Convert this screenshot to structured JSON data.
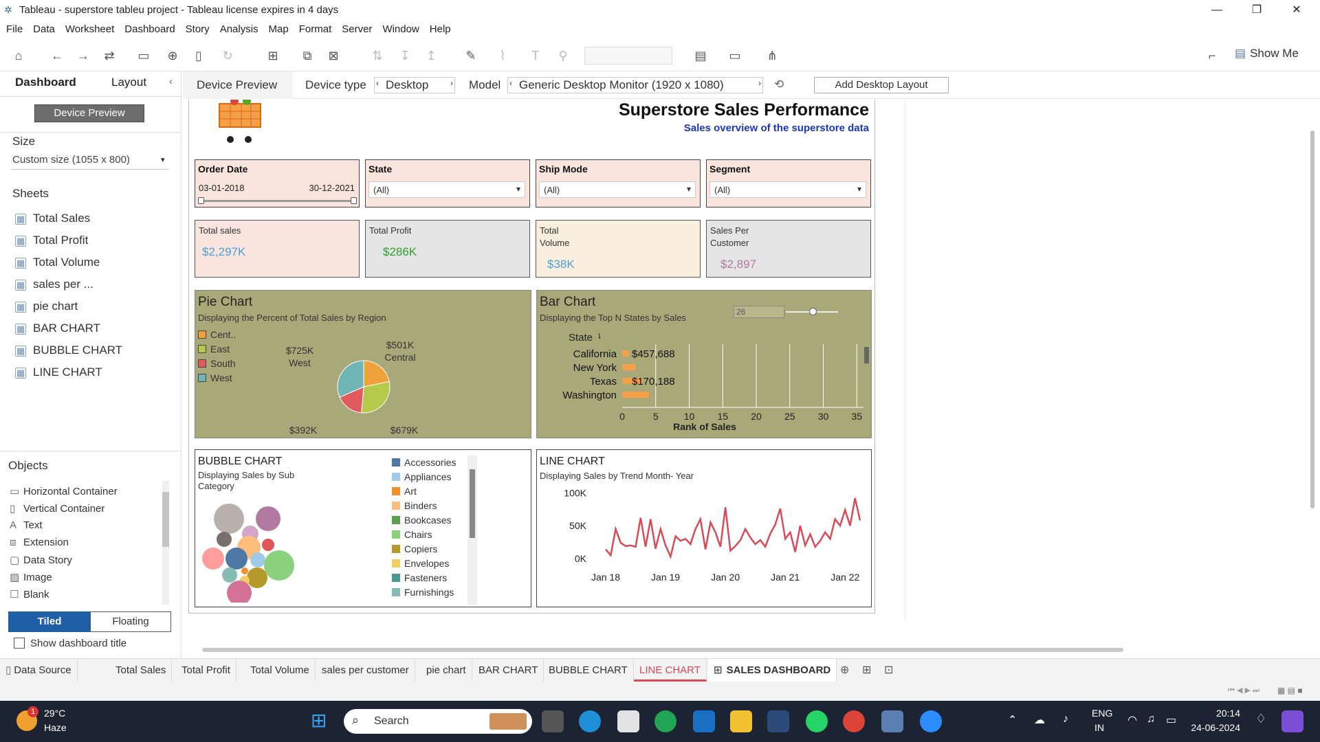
{
  "window": {
    "title": "Tableau - superstore tableu project - Tableau license expires in 4 days"
  },
  "menu": [
    "File",
    "Data",
    "Worksheet",
    "Dashboard",
    "Story",
    "Analysis",
    "Map",
    "Format",
    "Server",
    "Window",
    "Help"
  ],
  "toolbar": {
    "show_me": "Show Me"
  },
  "left_panel": {
    "tabs": {
      "dashboard": "Dashboard",
      "layout": "Layout"
    },
    "device_preview_btn": "Device Preview",
    "size_heading": "Size",
    "size_value": "Custom size (1055 x 800)",
    "sheets_heading": "Sheets",
    "sheets": [
      "Total Sales",
      "Total Profit",
      "Total Volume",
      "sales per ...",
      "pie chart",
      "BAR CHART",
      "BUBBLE CHART",
      "LINE CHART"
    ],
    "objects_heading": "Objects",
    "objects": [
      "Horizontal Container",
      "Vertical Container",
      "Text",
      "Extension",
      "Data Story",
      "Image",
      "Blank"
    ],
    "tiled": "Tiled",
    "floating": "Floating",
    "show_title": "Show dashboard title"
  },
  "device_bar": {
    "preview": "Device Preview",
    "device_type_label": "Device type",
    "device_type": "Desktop",
    "model_label": "Model",
    "model": "Generic Desktop Monitor (1920 x 1080)",
    "add_layout": "Add Desktop Layout"
  },
  "dashboard": {
    "title": "Superstore Sales Performance",
    "subtitle": "Sales overview of the superstore data",
    "filters": [
      {
        "label": "Order Date",
        "start": "03-01-2018",
        "end": "30-12-2021"
      },
      {
        "label": "State",
        "value": "(All)"
      },
      {
        "label": "Ship Mode",
        "value": "(All)"
      },
      {
        "label": "Segment",
        "value": "(All)"
      }
    ],
    "kpis": [
      {
        "label": "Total sales",
        "value": "$2,297K",
        "bg": "#f9e5dd",
        "color": "#4a9fd6"
      },
      {
        "label": "Total Profit",
        "value": "$286K",
        "bg": "#e5e5e5",
        "color": "#2e9e2e"
      },
      {
        "label": "Total\nVolume",
        "value": "$38K",
        "bg": "#faefde",
        "color": "#4a9fd6"
      },
      {
        "label": "Sales Per\nCustomer",
        "value": "$2,897",
        "bg": "#e5e5e5",
        "color": "#b07aa1"
      }
    ],
    "pie": {
      "title": "Pie Chart",
      "subtitle": "Displaying the Percent of Total Sales by Region",
      "legend": [
        {
          "name": "Cent..",
          "color": "#f0a23a"
        },
        {
          "name": "East",
          "color": "#b5c94a"
        },
        {
          "name": "South",
          "color": "#e05a5e"
        },
        {
          "name": "West",
          "color": "#6fb5b5"
        }
      ],
      "labels": [
        {
          "v": "$725K",
          "r": "West"
        },
        {
          "v": "$501K",
          "r": "Central"
        },
        {
          "v": "$392K",
          "r": "South"
        },
        {
          "v": "$679K",
          "r": "East"
        }
      ]
    },
    "bar": {
      "title": "Bar Chart",
      "subtitle": "Displaying the Top N States by Sales",
      "param": "26",
      "state_header": "State",
      "states": [
        "California",
        "New York",
        "Texas",
        "Washington"
      ],
      "labels": [
        "$457,688",
        "$170,188"
      ],
      "xlabel": "Rank of Sales",
      "ticks": [
        "0",
        "5",
        "10",
        "15",
        "20",
        "25",
        "30",
        "35"
      ]
    },
    "bubble": {
      "title": "BUBBLE CHART",
      "subtitle": "Displaying Sales by Sub\nCategory",
      "legend": [
        {
          "name": "Accessories",
          "color": "#4e79a7"
        },
        {
          "name": "Appliances",
          "color": "#a0cbe8"
        },
        {
          "name": "Art",
          "color": "#f28e2b"
        },
        {
          "name": "Binders",
          "color": "#ffbe7d"
        },
        {
          "name": "Bookcases",
          "color": "#59a14f"
        },
        {
          "name": "Chairs",
          "color": "#8cd17d"
        },
        {
          "name": "Copiers",
          "color": "#b6992d"
        },
        {
          "name": "Envelopes",
          "color": "#f1ce63"
        },
        {
          "name": "Fasteners",
          "color": "#499894"
        },
        {
          "name": "Furnishings",
          "color": "#86bcb6"
        }
      ]
    },
    "line": {
      "title": "LINE CHART",
      "subtitle": "Displaying Sales by Trend Month- Year",
      "yticks": [
        "100K",
        "50K",
        "0K"
      ],
      "xticks": [
        "Jan 18",
        "Jan 19",
        "Jan 20",
        "Jan 21",
        "Jan 22"
      ]
    }
  },
  "chart_data": [
    {
      "type": "pie",
      "title": "Pie Chart",
      "categories": [
        "Central",
        "East",
        "South",
        "West"
      ],
      "values": [
        501,
        679,
        392,
        725
      ]
    },
    {
      "type": "bar",
      "title": "Bar Chart",
      "xlabel": "Rank of Sales",
      "categories": [
        "California",
        "New York",
        "Texas",
        "Washington"
      ],
      "values": [
        1,
        2,
        3,
        4
      ]
    },
    {
      "type": "line",
      "title": "LINE CHART",
      "x": [
        "Jan 18",
        "",
        "",
        "",
        "",
        "",
        "",
        "",
        "",
        "",
        "",
        "",
        "Jan 19",
        "",
        "",
        "",
        "",
        "",
        "",
        "",
        "",
        "",
        "",
        "",
        "Jan 20",
        "",
        "",
        "",
        "",
        "",
        "",
        "",
        "",
        "",
        "",
        "",
        "Jan 21",
        "",
        "",
        "",
        "",
        "",
        "",
        "",
        "",
        "",
        "",
        "",
        "Jan 22"
      ],
      "values": [
        14,
        5,
        45,
        24,
        19,
        20,
        18,
        62,
        18,
        60,
        15,
        45,
        20,
        3,
        34,
        27,
        30,
        22,
        45,
        60,
        14,
        55,
        40,
        18,
        78,
        12,
        19,
        28,
        45,
        32,
        22,
        28,
        18,
        38,
        52,
        76,
        30,
        40,
        10,
        50,
        20,
        37,
        18,
        27,
        40,
        30,
        60,
        50,
        74,
        50,
        92,
        58
      ],
      "ylim": [
        0,
        115
      ],
      "yticks": [
        0,
        50000,
        100000
      ]
    }
  ],
  "tabs_bottom": [
    "Data Source",
    "Total Sales",
    "Total Profit",
    "Total Volume",
    "sales per customer",
    "pie chart",
    "BAR CHART",
    "BUBBLE CHART",
    "LINE CHART",
    "SALES DASHBOARD"
  ],
  "taskbar": {
    "temp": "29°C",
    "weather": "Haze",
    "search": "Search",
    "lang1": "ENG",
    "lang2": "IN",
    "time": "20:14",
    "date": "24-06-2024",
    "badge": "1"
  }
}
